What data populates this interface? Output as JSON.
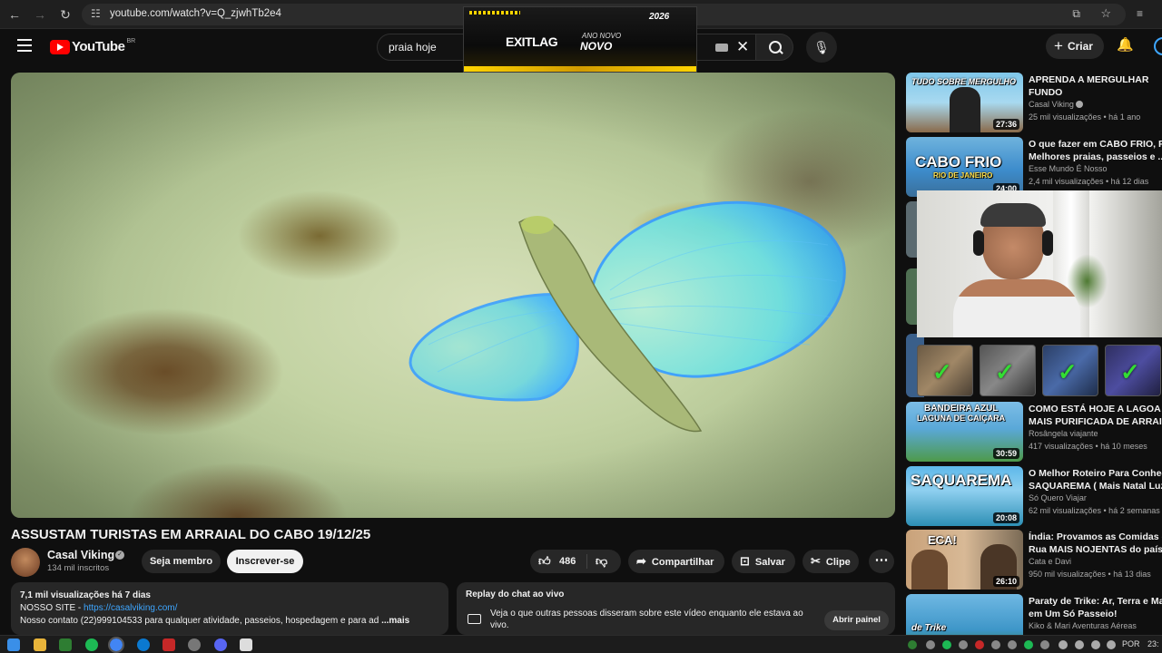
{
  "browser": {
    "url": "youtube.com/watch?v=Q_zjwhTb2e4",
    "back_icon": "arrow-left-icon",
    "forward_icon": "arrow-right-icon",
    "reload_icon": "reload-icon"
  },
  "header": {
    "logo_text": "YouTube",
    "country_code": "BR",
    "search_value": "praia hoje",
    "create_label": "Criar"
  },
  "ad": {
    "brand": "EXITLAG",
    "year": "2026",
    "tagline_small": "ANO NOVO",
    "tagline_big": "NOVO"
  },
  "video": {
    "title": "ASSUSTAM TURISTAS EM ARRAIAL DO CABO 19/12/25",
    "channel": "Casal Viking",
    "subscribers": "134 mil inscritos",
    "member_label": "Seja membro",
    "subscribe_label": "Inscrever-se",
    "likes": "486",
    "share_label": "Compartilhar",
    "save_label": "Salvar",
    "clip_label": "Clipe",
    "more_label": "⋯"
  },
  "description": {
    "stats": "7,1 mil visualizações  há 7 dias",
    "site_prefix": "NOSSO SITE - ",
    "site_link": "https://casalviking.com/",
    "contact": "Nosso contato (22)999104533 para qualquer atividade, passeios, hospedagem e para ad",
    "more": "...mais"
  },
  "chat": {
    "title": "Replay do chat ao vivo",
    "desc": "Veja o que outras pessoas disseram sobre este vídeo enquanto ele estava ao vivo.",
    "open_label": "Abrir painel"
  },
  "recommendations": [
    {
      "thumb_text": "TUDO SOBRE MERGULHO",
      "duration": "27:36",
      "title_1": "APRENDA A MERGULHAR",
      "title_2": "FUNDO",
      "channel": "Casal Viking",
      "meta": "25 mil visualizações • há 1 ano"
    },
    {
      "thumb_text": "CABO FRIO",
      "thumb_sub": "RIO DE JANEIRO",
      "duration": "24:00",
      "title_1": "O que fazer em CABO FRIO, RJ",
      "title_2": "Melhores praias, passeios e ...",
      "channel": "Esse Mundo É Nosso",
      "meta": "2,4 mil visualizações • há 12 dias"
    },
    {
      "thumb_text": "BANDEIRA AZUL",
      "thumb_sub": "LAGUNA DE CAIÇARA",
      "duration": "30:59",
      "title_1": "COMO ESTÁ HOJE A LAGOA",
      "title_2": "MAIS PURIFICADA DE ARRAIAL",
      "channel": "Rosângela viajante",
      "meta": "417 visualizações • há 10 meses"
    },
    {
      "thumb_text": "SAQUAREMA",
      "duration": "20:08",
      "title_1": "O Melhor Roteiro Para Conhecer",
      "title_2": "SAQUAREMA ( Mais Natal Luz",
      "channel": "Só Quero Viajar",
      "meta": "62 mil visualizações • há 2 semanas"
    },
    {
      "thumb_text": "ECA!",
      "duration": "26:10",
      "title_1": "Índia: Provamos as Comidas de",
      "title_2": "Rua MAIS NOJENTAS do país!",
      "channel": "Cata e Davi",
      "meta": "950 mil visualizações • há 13 dias"
    },
    {
      "thumb_text": "de Trike",
      "title_1": "Paraty de Trike: Ar, Terra e Mar",
      "title_2": "em Um Só Passeio!",
      "channel": "Kiko & Mari Aventuras Aéreas",
      "meta": ""
    }
  ],
  "taskbar": {
    "lang": "POR",
    "clock": "23:"
  },
  "colors": {
    "background": "#0f0f0f",
    "accent_red": "#ff0000",
    "link_blue": "#3ea6ff",
    "check_green": "#33dd33"
  }
}
